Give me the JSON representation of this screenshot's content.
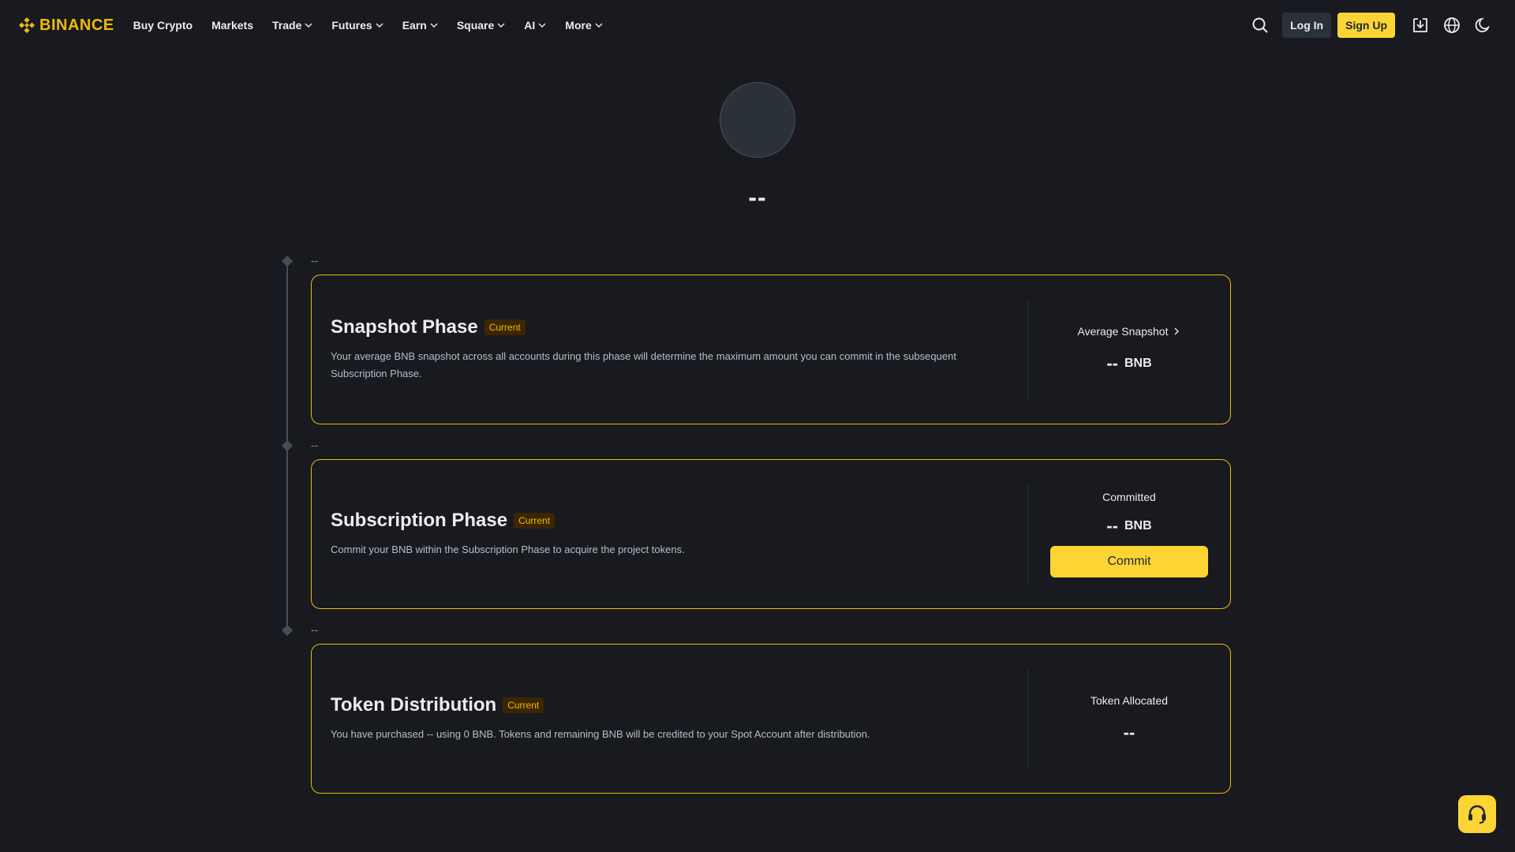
{
  "header": {
    "logo_text": "BINANCE",
    "nav": [
      {
        "label": "Buy Crypto",
        "has_dropdown": false
      },
      {
        "label": "Markets",
        "has_dropdown": false
      },
      {
        "label": "Trade",
        "has_dropdown": true
      },
      {
        "label": "Futures",
        "has_dropdown": true
      },
      {
        "label": "Earn",
        "has_dropdown": true
      },
      {
        "label": "Square",
        "has_dropdown": true
      },
      {
        "label": "AI",
        "has_dropdown": true
      },
      {
        "label": "More",
        "has_dropdown": true
      }
    ],
    "login_label": "Log In",
    "signup_label": "Sign Up",
    "icons": [
      "search-icon",
      "download-icon",
      "globe-icon",
      "moon-icon"
    ]
  },
  "project": {
    "name": "--"
  },
  "phases": [
    {
      "date": "--",
      "title": "Snapshot Phase",
      "badge": "Current",
      "description": "Your average BNB snapshot across all accounts during this phase will determine the maximum amount you can commit in the subsequent Subscription Phase.",
      "stat_label": "Average Snapshot",
      "stat_value": "--",
      "stat_unit": "BNB"
    },
    {
      "date": "--",
      "title": "Subscription Phase",
      "badge": "Current",
      "description": "Commit your BNB within the Subscription Phase to acquire the project tokens.",
      "stat_label": "Committed",
      "stat_value": "--",
      "stat_unit": "BNB",
      "button_label": "Commit"
    },
    {
      "date": "--",
      "title": "Token Distribution",
      "badge": "Current",
      "description": "You have purchased -- using 0 BNB. Tokens and remaining BNB will be credited to your Spot Account after distribution.",
      "stat_label": "Token Allocated",
      "stat_value": "--"
    }
  ],
  "colors": {
    "background": "#181a20",
    "accent": "#f0b90b",
    "button_yellow": "#fcd535"
  }
}
